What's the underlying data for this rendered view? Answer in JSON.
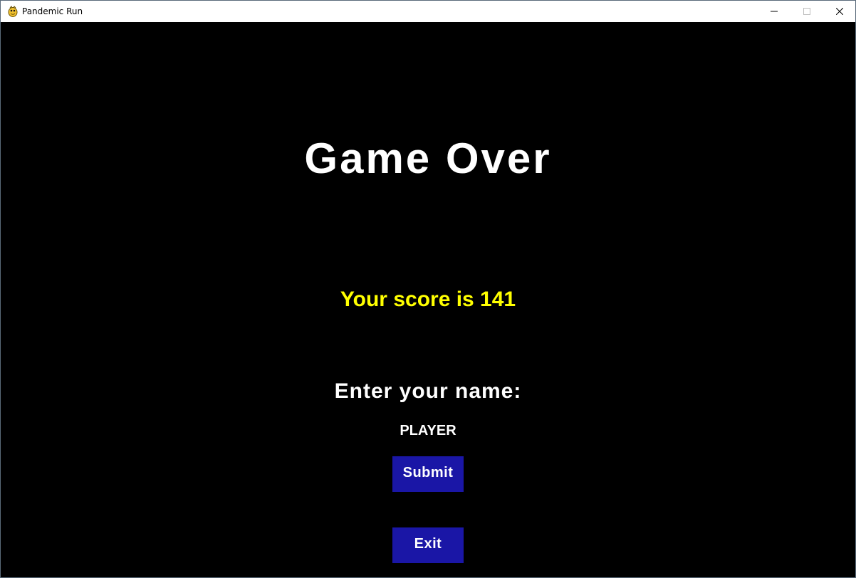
{
  "window": {
    "title": "Pandemic Run",
    "icon": "pygame-snake-icon",
    "controls": {
      "minimize": "minimize-icon",
      "maximize": "maximize-icon",
      "close": "close-icon"
    }
  },
  "game": {
    "heading": "Game Over",
    "score_text": "Your score is 141",
    "score": 141,
    "name_prompt": "Enter your name:",
    "name_value": "PLAYER",
    "submit_label": "Submit",
    "exit_label": "Exit"
  },
  "colors": {
    "background": "#000000",
    "heading": "#ffffff",
    "score": "#ffff00",
    "button": "#1a16a6",
    "button_text": "#ffffff"
  }
}
